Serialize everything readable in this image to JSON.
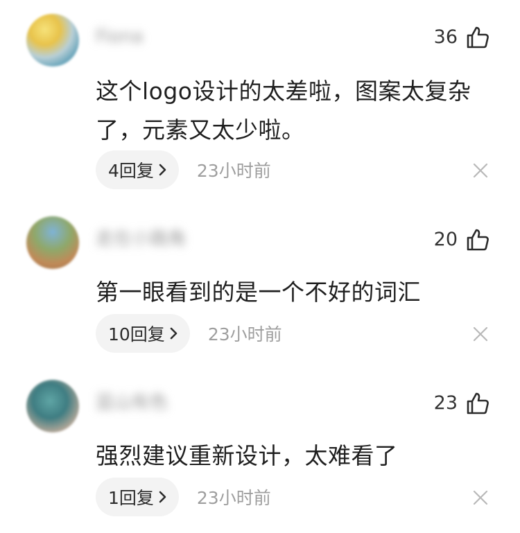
{
  "comments": [
    {
      "username": "Fiona",
      "likes": "36",
      "text": "这个logo设计的太差啦，图案太复杂了，元素又太少啦。",
      "reply_label": "4回复",
      "time": "23小时前"
    },
    {
      "username": "走在小路角",
      "likes": "20",
      "text": "第一眼看到的是一个不好的词汇",
      "reply_label": "10回复",
      "time": "23小时前"
    },
    {
      "username": "蓝山有色",
      "likes": "23",
      "text": "强烈建议重新设计，太难看了",
      "reply_label": "1回复",
      "time": "23小时前"
    }
  ],
  "icons": {
    "like": "thumbs-up-icon",
    "reply_chevron": "chevron-right-icon",
    "dismiss": "close-icon"
  },
  "colors": {
    "text": "#1f1f1f",
    "muted": "#9e9e9e",
    "pill_bg": "#f3f3f3"
  }
}
